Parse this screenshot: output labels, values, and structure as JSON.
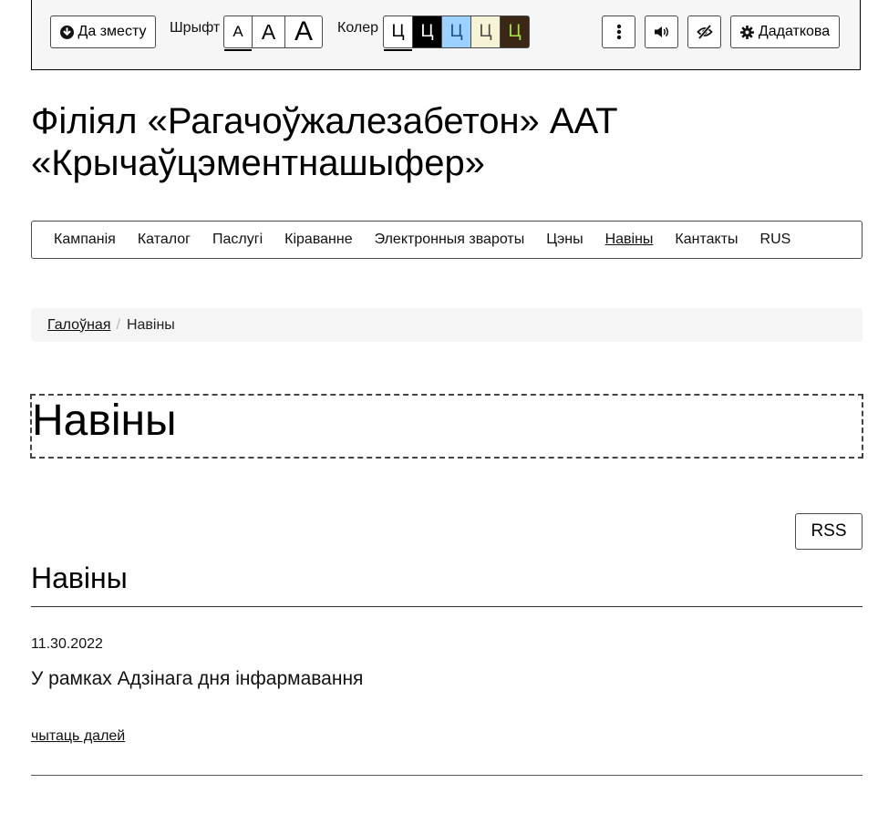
{
  "toolbar": {
    "skip_label": "Да зместу",
    "font_label": "Шрыфт",
    "font_sizes": [
      "A",
      "A",
      "A"
    ],
    "color_label": "Колер",
    "color_schemes": [
      {
        "glyph": "Ц",
        "bg": "#ffffff",
        "fg": "#000000"
      },
      {
        "glyph": "Ц",
        "bg": "#000000",
        "fg": "#ffffff"
      },
      {
        "glyph": "Ц",
        "bg": "#9dd1ff",
        "fg": "#195183"
      },
      {
        "glyph": "Ц",
        "bg": "#f7f3d6",
        "fg": "#4d4b43"
      },
      {
        "glyph": "Ц",
        "bg": "#3b2716",
        "fg": "#a9e44d"
      }
    ],
    "more_label": "Дадаткова"
  },
  "site": {
    "title": "Філіял «Рагачоўжалезабетон» ААТ «Крычаўцэментнашыфер»"
  },
  "nav": {
    "items": [
      "Кампанія",
      "Каталог",
      "Паслугі",
      "Кіраванне",
      "Электронныя звароты",
      "Цэны",
      "Навіны",
      "Кантакты",
      "RUS"
    ],
    "current_index": 6
  },
  "breadcrumb": {
    "home": "Галоўная",
    "separator": "/",
    "current": "Навіны"
  },
  "page": {
    "heading": "Навіны",
    "rss_label": "RSS",
    "section_heading": "Навіны"
  },
  "news": {
    "date": "11.30.2022",
    "title": "У рамках Адзінага дня інфармавання",
    "read_more": "чытаць далей"
  },
  "colors": {
    "toolbar_bg": "#f6f6f6",
    "breadcrumb_bg": "#f5f5f5"
  }
}
